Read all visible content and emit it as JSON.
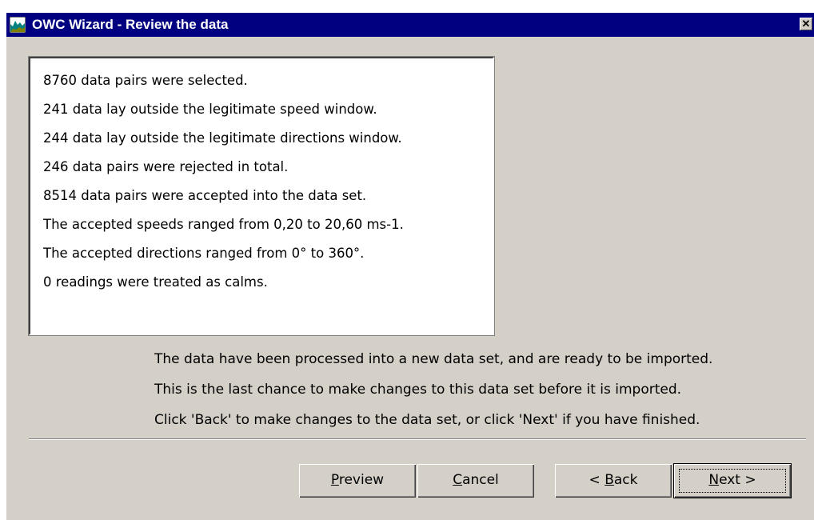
{
  "window": {
    "title": "OWC Wizard - Review the data",
    "close_glyph": "✕"
  },
  "summary": {
    "lines": [
      "8760 data pairs were selected.",
      "241 data lay outside the legitimate speed window.",
      "244 data lay outside the legitimate directions window.",
      "246 data pairs were rejected in total.",
      "8514 data pairs were accepted into the data set.",
      "The accepted speeds ranged from 0,20 to 20,60 ms-1.",
      "The accepted directions ranged from 0° to 360°.",
      "0 readings were treated as calms."
    ]
  },
  "info": {
    "lines": [
      "The data have been processed into a new data set, and are ready to be imported.",
      "This is the last chance to make changes to this data set before it is imported.",
      "Click 'Back' to make changes to the data set, or click 'Next' if you have finished."
    ]
  },
  "buttons": {
    "preview": {
      "accel": "P",
      "rest": "review"
    },
    "cancel": {
      "accel": "C",
      "rest": "ancel"
    },
    "back": {
      "pre": "< ",
      "accel": "B",
      "rest": "ack"
    },
    "next": {
      "accel": "N",
      "rest": "ext >"
    }
  },
  "colors": {
    "titlebar": "#000080",
    "dialog_face": "#d4d0c8",
    "panel": "#ffffff"
  }
}
